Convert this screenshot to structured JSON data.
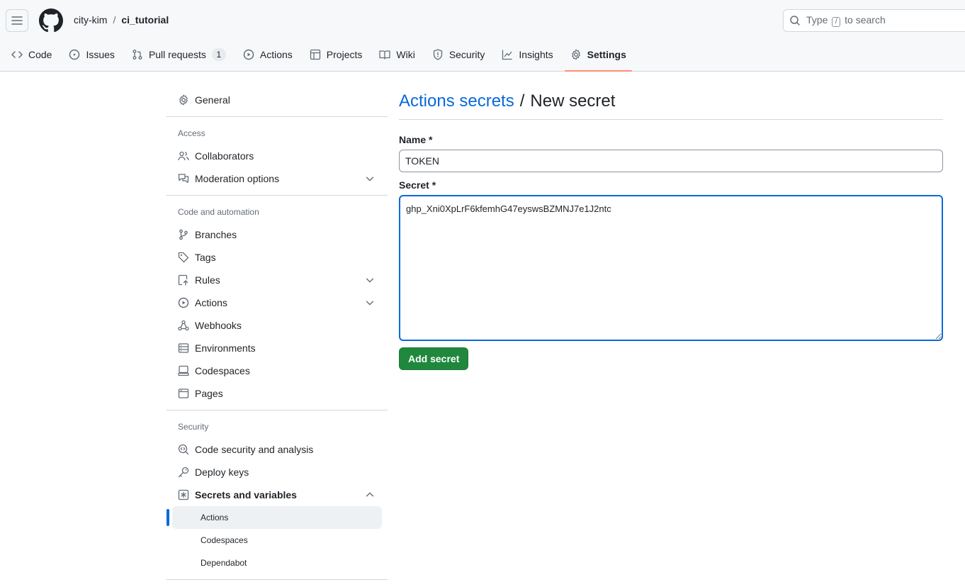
{
  "header": {
    "owner": "city-kim",
    "separator": "/",
    "repo": "ci_tutorial",
    "search_prefix": "Type",
    "search_key": "/",
    "search_suffix": "to search"
  },
  "nav": {
    "tabs": [
      {
        "label": "Code",
        "icon": "code-icon"
      },
      {
        "label": "Issues",
        "icon": "issue-icon"
      },
      {
        "label": "Pull requests",
        "icon": "pull-request-icon",
        "count": "1"
      },
      {
        "label": "Actions",
        "icon": "play-icon"
      },
      {
        "label": "Projects",
        "icon": "table-icon"
      },
      {
        "label": "Wiki",
        "icon": "book-icon"
      },
      {
        "label": "Security",
        "icon": "shield-icon"
      },
      {
        "label": "Insights",
        "icon": "graph-icon"
      },
      {
        "label": "Settings",
        "icon": "gear-icon",
        "selected": true
      }
    ]
  },
  "sidebar": {
    "general": "General",
    "access_heading": "Access",
    "collaborators": "Collaborators",
    "moderation": "Moderation options",
    "code_heading": "Code and automation",
    "branches": "Branches",
    "tags": "Tags",
    "rules": "Rules",
    "actions": "Actions",
    "webhooks": "Webhooks",
    "environments": "Environments",
    "codespaces": "Codespaces",
    "pages": "Pages",
    "security_heading": "Security",
    "code_security": "Code security and analysis",
    "deploy_keys": "Deploy keys",
    "secrets": "Secrets and variables",
    "sub_actions": "Actions",
    "sub_codespaces": "Codespaces",
    "sub_dependabot": "Dependabot"
  },
  "main": {
    "title_link": "Actions secrets",
    "title_sep": "/",
    "title_rest": "New secret",
    "name_label": "Name *",
    "name_value": "TOKEN",
    "secret_label": "Secret *",
    "secret_value": "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",
    "add_button": "Add secret"
  },
  "colors": {
    "accent": "#0969da",
    "primary_button": "#1f883d",
    "selected_tab_underline": "#fd8c73"
  }
}
